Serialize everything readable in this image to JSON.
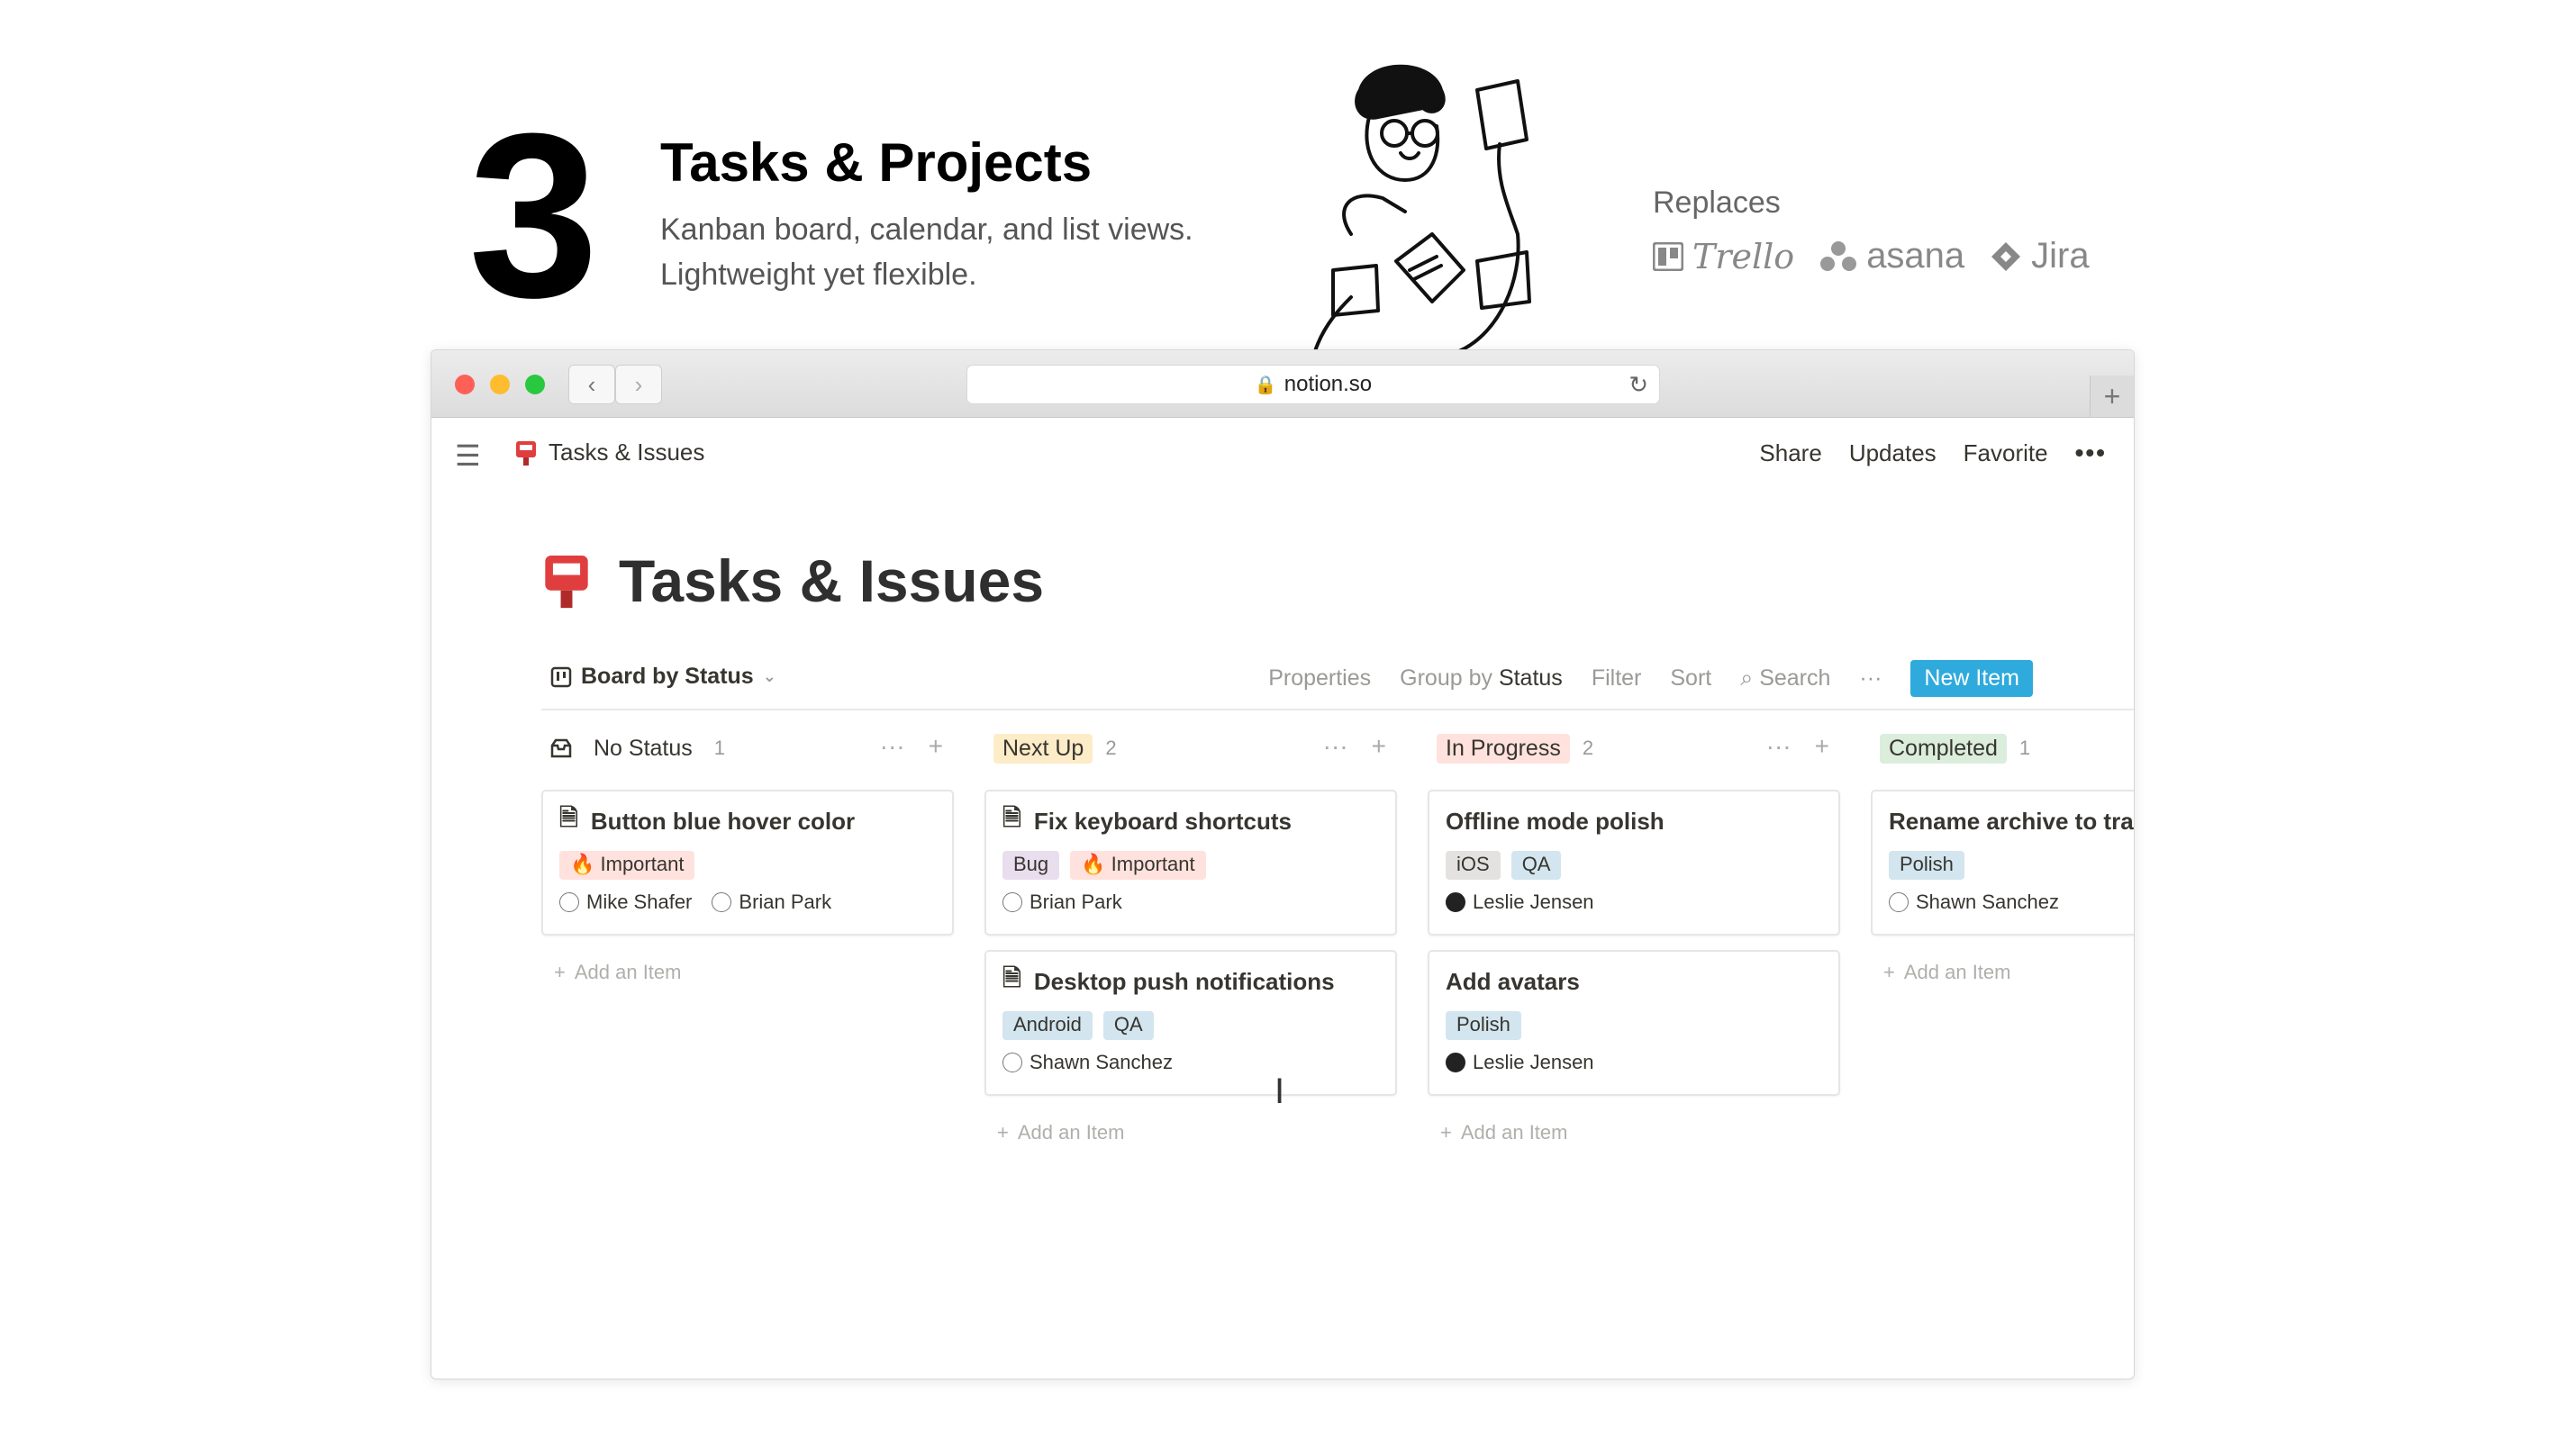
{
  "hero": {
    "number": "3",
    "title": "Tasks & Projects",
    "subtitle_line1": "Kanban board, calendar, and list views.",
    "subtitle_line2": "Lightweight yet flexible.",
    "replaces_label": "Replaces",
    "brands": [
      "Trello",
      "asana",
      "Jira"
    ]
  },
  "browser": {
    "url": "notion.so",
    "icons": {
      "back": "chevron-left-icon",
      "forward": "chevron-right-icon",
      "lock": "lock-icon",
      "reload": "reload-icon",
      "new_tab": "plus-icon"
    }
  },
  "topbar": {
    "breadcrumb": "Tasks & Issues",
    "actions": [
      "Share",
      "Updates",
      "Favorite"
    ],
    "more": "•••"
  },
  "page": {
    "title": "Tasks & Issues",
    "icon": "red-mailbox-icon"
  },
  "view": {
    "name": "Board by Status",
    "properties": "Properties",
    "group_by_label": "Group by",
    "group_by_value": "Status",
    "filter": "Filter",
    "sort": "Sort",
    "search": "Search",
    "more": "···",
    "new_item": "New Item"
  },
  "colors": {
    "accent": "#2eaadc",
    "next_up": "#fdecc8",
    "in_progress": "#ffe2dd",
    "completed": "#dbeddb",
    "bug": "#e8deee",
    "important": "#ffe2dd",
    "qa": "#d3e5ef",
    "ios": "#e3e2e0",
    "polish": "#d3e5ef"
  },
  "board": {
    "add_item_label": "Add an Item",
    "columns": [
      {
        "label": "No Status",
        "count": "1",
        "cards": [
          {
            "title": "Button blue hover color",
            "tags": [
              "🔥 Important"
            ],
            "people": [
              "Mike Shafer",
              "Brian Park"
            ]
          }
        ]
      },
      {
        "label": "Next Up",
        "count": "2",
        "cards": [
          {
            "title": "Fix keyboard shortcuts",
            "tags": [
              "Bug",
              "🔥 Important"
            ],
            "people": [
              "Brian Park"
            ]
          },
          {
            "title": "Desktop push notifications",
            "tags": [
              "Android",
              "QA"
            ],
            "people": [
              "Shawn Sanchez"
            ]
          }
        ]
      },
      {
        "label": "In Progress",
        "count": "2",
        "cards": [
          {
            "title": "Offline mode polish",
            "tags": [
              "iOS",
              "QA"
            ],
            "people": [
              "Leslie Jensen"
            ]
          },
          {
            "title": "Add avatars",
            "tags": [
              "Polish"
            ],
            "people": [
              "Leslie Jensen"
            ]
          }
        ]
      },
      {
        "label": "Completed",
        "count": "1",
        "cards": [
          {
            "title": "Rename archive to trash",
            "tags": [
              "Polish"
            ],
            "people": [
              "Shawn Sanchez"
            ]
          }
        ]
      }
    ]
  }
}
